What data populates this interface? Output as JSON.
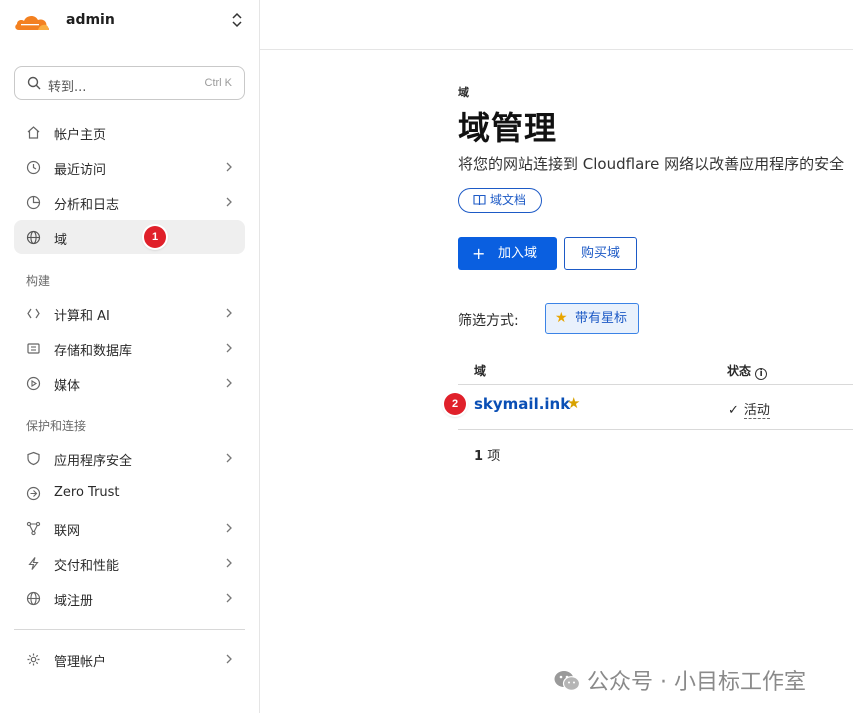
{
  "account": {
    "name": "admin"
  },
  "search": {
    "placeholder": "转到...",
    "shortcut": "Ctrl K"
  },
  "sidebar": {
    "items": [
      {
        "label": "帐户主页",
        "icon": "home-icon",
        "chevron": false
      },
      {
        "label": "最近访问",
        "icon": "clock-icon",
        "chevron": true
      },
      {
        "label": "分析和日志",
        "icon": "pie-chart-icon",
        "chevron": true
      },
      {
        "label": "域",
        "icon": "globe-icon",
        "chevron": false,
        "active": true
      },
      {
        "label": "计算和 AI",
        "icon": "code-icon",
        "chevron": true
      },
      {
        "label": "存储和数据库",
        "icon": "database-icon",
        "chevron": true
      },
      {
        "label": "媒体",
        "icon": "play-icon",
        "chevron": true
      },
      {
        "label": "应用程序安全",
        "icon": "shield-icon",
        "chevron": true
      },
      {
        "label": "Zero Trust",
        "icon": "zero-trust-icon",
        "chevron": false
      },
      {
        "label": "联网",
        "icon": "network-icon",
        "chevron": true
      },
      {
        "label": "交付和性能",
        "icon": "lightning-icon",
        "chevron": true
      },
      {
        "label": "域注册",
        "icon": "globe-icon",
        "chevron": true
      },
      {
        "label": "管理帐户",
        "icon": "gear-icon",
        "chevron": true
      }
    ],
    "sections": {
      "build": "构建",
      "protect": "保护和连接"
    }
  },
  "badges": {
    "step1": "1",
    "step2": "2"
  },
  "main": {
    "breadcrumb": "域",
    "title": "域管理",
    "description": "将您的网站连接到 Cloudflare 网络以改善应用程序的安全",
    "doc_link": "域文档",
    "add_domain": "加入域",
    "buy_domain": "购买域",
    "filter_label": "筛选方式:",
    "filter_chip": "带有星标"
  },
  "table": {
    "headers": {
      "domain": "域",
      "status": "状态"
    },
    "rows": [
      {
        "domain": "skymail.ink",
        "starred": true,
        "status": "活动"
      }
    ],
    "count_num": "1",
    "count_unit": "项"
  },
  "watermark": "公众号 · 小目标工作室",
  "colors": {
    "accent": "#0a5fe0",
    "link": "#0a4fb5",
    "star": "#e8a500",
    "badge": "#e0202a",
    "logo": "#f38020"
  }
}
